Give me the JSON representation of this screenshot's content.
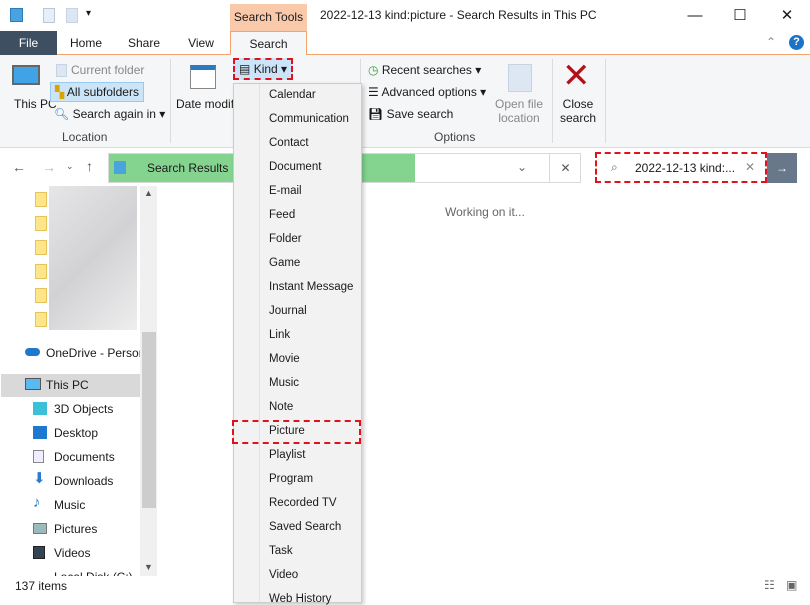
{
  "window": {
    "title": "2022-12-13 kind:picture - Search Results in This PC",
    "context_tab": "Search Tools",
    "minimize": "—",
    "maximize": "☐",
    "close": "✕"
  },
  "tabs": [
    "File",
    "Home",
    "Share",
    "View",
    "Search"
  ],
  "ribbon": {
    "location": {
      "this_pc": "This PC",
      "current_folder": "Current folder",
      "all_subfolders": "All subfolders",
      "search_again": "Search again in",
      "group": "Location"
    },
    "refine": {
      "date_modified": "Date modified",
      "kind": "Kind"
    },
    "options": {
      "recent": "Recent searches",
      "advanced": "Advanced options",
      "save": "Save search",
      "open_location": "Open file location",
      "close_search": "Close search",
      "group": "Options"
    }
  },
  "address": {
    "path": "Search Results in This PC",
    "search_value": "2022-12-13 kind:...",
    "progress": 0.65
  },
  "kind_menu": [
    "Calendar",
    "Communication",
    "Contact",
    "Document",
    "E-mail",
    "Feed",
    "Folder",
    "Game",
    "Instant Message",
    "Journal",
    "Link",
    "Movie",
    "Music",
    "Note",
    "Picture",
    "Playlist",
    "Program",
    "Recorded TV",
    "Saved Search",
    "Task",
    "Video",
    "Web History"
  ],
  "nav": {
    "onedrive": "OneDrive - Persor",
    "this_pc": "This PC",
    "items": [
      "3D Objects",
      "Desktop",
      "Documents",
      "Downloads",
      "Music",
      "Pictures",
      "Videos",
      "Local Disk (C:)"
    ]
  },
  "content": {
    "status": "Working on it..."
  },
  "statusbar": {
    "count": "137 items"
  }
}
